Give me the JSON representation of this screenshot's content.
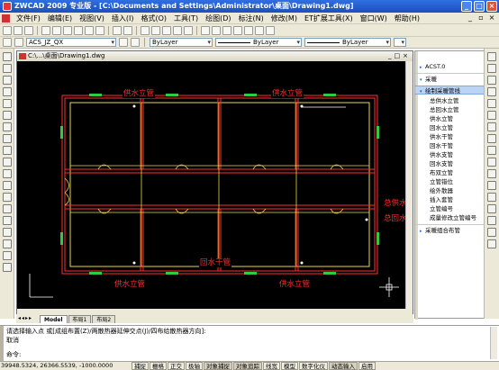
{
  "window": {
    "title": "ZWCAD 2009 专业版 - [C:\\Documents and Settings\\Administrator\\桌面\\Drawing1.dwg]"
  },
  "menu": [
    "文件(F)",
    "编辑(E)",
    "视图(V)",
    "插入(I)",
    "格式(O)",
    "工具(T)",
    "绘图(D)",
    "标注(N)",
    "修改(M)",
    "ET扩展工具(X)",
    "窗口(W)",
    "帮助(H)"
  ],
  "toolbar2": {
    "layer": "ACS_JZ_QX",
    "color": "ByLayer",
    "linetype": "ByLayer",
    "lineweight": "ByLayer"
  },
  "drawing_window": {
    "title": "C:\\...\\桌面\\Drawing1.dwg"
  },
  "canvas_labels": {
    "top_left": "供水立管",
    "top_right": "供水立管",
    "right_supply": "总供水立管",
    "right_return": "总回水立管",
    "return_main": "回水干管",
    "bottom_left": "供水立管",
    "bottom_right": "供水立管"
  },
  "layout_tabs": [
    "Model",
    "布局1",
    "布局2"
  ],
  "panel": {
    "items": [
      {
        "label": "ACST.0",
        "level": 0,
        "arrow": "▸"
      },
      {
        "label": "采暖",
        "level": 0,
        "arrow": "▾"
      },
      {
        "label": "绘制采暖管线",
        "level": 0,
        "arrow": "▾",
        "highlight": true
      },
      {
        "label": "总供水立管",
        "level": 1
      },
      {
        "label": "总回水立管",
        "level": 1
      },
      {
        "label": "供水立管",
        "level": 1
      },
      {
        "label": "回水立管",
        "level": 1
      },
      {
        "label": "供水干管",
        "level": 1
      },
      {
        "label": "回水干管",
        "level": 1
      },
      {
        "label": "供水支管",
        "level": 1
      },
      {
        "label": "回水支管",
        "level": 1
      },
      {
        "label": "布双立管",
        "level": 1
      },
      {
        "label": "立管错位",
        "level": 1
      },
      {
        "label": "绘外散器",
        "level": 1
      },
      {
        "label": "插入套管",
        "level": 1
      },
      {
        "label": "立管编号",
        "level": 1
      },
      {
        "label": "成量修改立管编号",
        "level": 1
      },
      {
        "label": "采暖组合布管",
        "level": 0,
        "arrow": "▸"
      }
    ]
  },
  "command": {
    "line1": "请选择输入点 或[成组布置(Z)/两散热器延伸交点(J)/四布给散热器方向]:",
    "line2": "取消",
    "line3": "命令:"
  },
  "status": {
    "coords": "39948.5324, 26366.5539, -1000.0000",
    "buttons": [
      "捕捉",
      "栅格",
      "正交",
      "极轴",
      "对象捕捉",
      "对象追踪",
      "线宽",
      "模型",
      "数字化仪",
      "动态输入",
      "启用"
    ]
  }
}
